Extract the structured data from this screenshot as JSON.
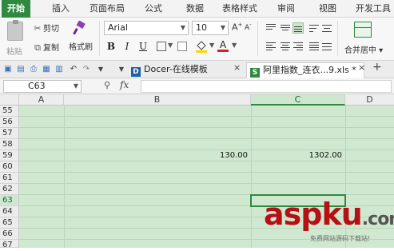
{
  "menu": {
    "tabs": [
      "开始",
      "插入",
      "页面布局",
      "公式",
      "数据",
      "表格样式",
      "审阅",
      "视图",
      "开发工具"
    ],
    "active_index": 0
  },
  "ribbon": {
    "paste_label": "粘贴",
    "cut_label": "剪切",
    "copy_label": "复制",
    "format_painter_label": "格式刷",
    "font_name": "Arial",
    "font_size": "10",
    "bold": "B",
    "italic": "I",
    "underline": "U",
    "merge_center_label": "合并居中"
  },
  "doc_tabs": {
    "tab1_label": "Docer-在线模板",
    "tab1_close": "×",
    "tab2_label": "阿里指数_连衣...9.xls *",
    "tab2_close": "×",
    "add_tab": "+"
  },
  "formula_bar": {
    "name_box": "C63",
    "fx_label": "fx",
    "formula_value": ""
  },
  "sheet": {
    "columns": [
      "A",
      "B",
      "C",
      "D"
    ],
    "selected_column": "C",
    "rows": [
      "55",
      "56",
      "57",
      "58",
      "59",
      "60",
      "61",
      "62",
      "63",
      "64",
      "65",
      "66",
      "67"
    ],
    "selected_row": "63",
    "cells": {
      "B59": "130.00",
      "C59": "1302.00"
    }
  },
  "watermark": {
    "brand": "aspku",
    "tld": ".com",
    "tagline": "免费网站源码下载站!"
  },
  "colors": {
    "accent_green": "#2f8a3f",
    "grid_background": "#cfe8cf",
    "watermark_red": "#b60f14"
  }
}
